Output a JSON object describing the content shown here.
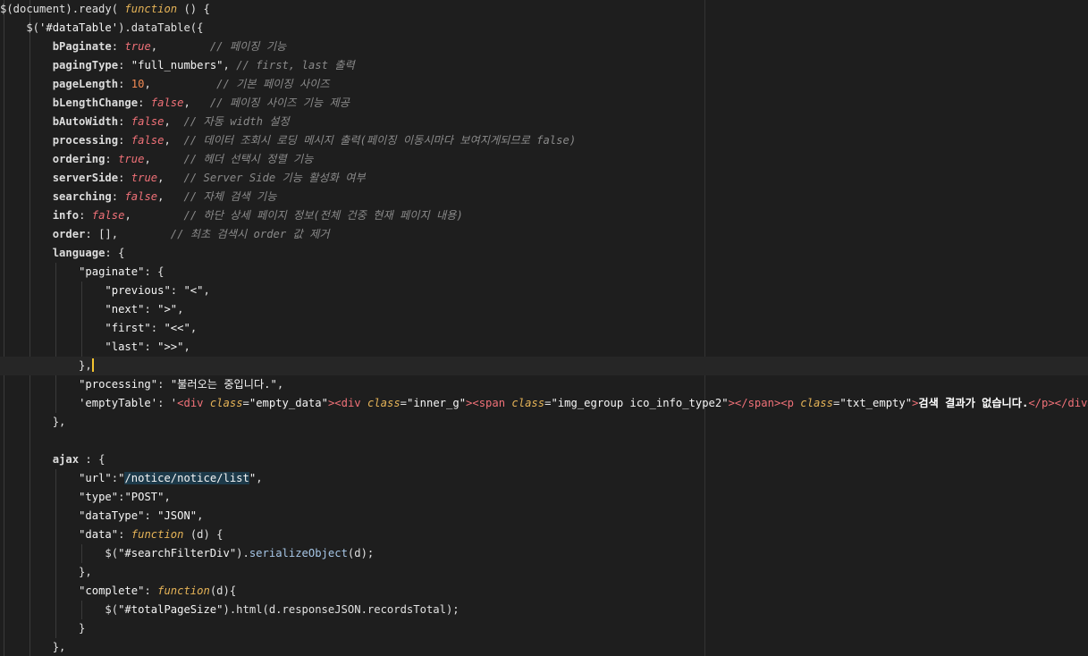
{
  "editor": {
    "colors": {
      "background": "#1e1e1e",
      "current_line": "#262626",
      "cursor": "#f4c430",
      "plain": "#e0e0e0",
      "keyword": "#e5b357",
      "boolean": "#f07178",
      "number": "#f28b54",
      "comment": "#8a8a8a",
      "tag": "#f07178"
    },
    "lines": [
      [
        [
          "plain",
          "$(document).ready( "
        ],
        [
          "kw",
          "function"
        ],
        [
          "plain",
          " () {"
        ]
      ],
      [
        [
          "plain",
          "    $("
        ],
        [
          "str",
          "'#dataTable'"
        ],
        [
          "plain",
          ").dataTable({"
        ]
      ],
      [
        [
          "plain",
          "        "
        ],
        [
          "key",
          "bPaginate"
        ],
        [
          "plain",
          ": "
        ],
        [
          "bool",
          "true"
        ],
        [
          "plain",
          ",        "
        ],
        [
          "cmt",
          "// 페이징 기능"
        ]
      ],
      [
        [
          "plain",
          "        "
        ],
        [
          "key",
          "pagingType"
        ],
        [
          "plain",
          ": "
        ],
        [
          "str",
          "\"full_numbers\""
        ],
        [
          "plain",
          ", "
        ],
        [
          "cmt",
          "// first, last 출력"
        ]
      ],
      [
        [
          "plain",
          "        "
        ],
        [
          "key",
          "pageLength"
        ],
        [
          "plain",
          ": "
        ],
        [
          "num",
          "10"
        ],
        [
          "plain",
          ",          "
        ],
        [
          "cmt",
          "// 기본 페이징 사이즈"
        ]
      ],
      [
        [
          "plain",
          "        "
        ],
        [
          "key",
          "bLengthChange"
        ],
        [
          "plain",
          ": "
        ],
        [
          "bool",
          "false"
        ],
        [
          "plain",
          ",   "
        ],
        [
          "cmt",
          "// 페이징 사이즈 기능 제공"
        ]
      ],
      [
        [
          "plain",
          "        "
        ],
        [
          "key",
          "bAutoWidth"
        ],
        [
          "plain",
          ": "
        ],
        [
          "bool",
          "false"
        ],
        [
          "plain",
          ",  "
        ],
        [
          "cmt",
          "// 자동 width 설정"
        ]
      ],
      [
        [
          "plain",
          "        "
        ],
        [
          "key",
          "processing"
        ],
        [
          "plain",
          ": "
        ],
        [
          "bool",
          "false"
        ],
        [
          "plain",
          ",  "
        ],
        [
          "cmt",
          "// 데이터 조회시 로딩 메시지 출력(페이징 이동시마다 보여지게되므로 false)"
        ]
      ],
      [
        [
          "plain",
          "        "
        ],
        [
          "key",
          "ordering"
        ],
        [
          "plain",
          ": "
        ],
        [
          "bool",
          "true"
        ],
        [
          "plain",
          ",     "
        ],
        [
          "cmt",
          "// 헤더 선택시 정렬 기능"
        ]
      ],
      [
        [
          "plain",
          "        "
        ],
        [
          "key",
          "serverSide"
        ],
        [
          "plain",
          ": "
        ],
        [
          "bool",
          "true"
        ],
        [
          "plain",
          ",   "
        ],
        [
          "cmt",
          "// Server Side 기능 활성화 여부"
        ]
      ],
      [
        [
          "plain",
          "        "
        ],
        [
          "key",
          "searching"
        ],
        [
          "plain",
          ": "
        ],
        [
          "bool",
          "false"
        ],
        [
          "plain",
          ",   "
        ],
        [
          "cmt",
          "// 자체 검색 기능"
        ]
      ],
      [
        [
          "plain",
          "        "
        ],
        [
          "key",
          "info"
        ],
        [
          "plain",
          ": "
        ],
        [
          "bool",
          "false"
        ],
        [
          "plain",
          ",        "
        ],
        [
          "cmt",
          "// 하단 상세 페이지 정보(전체 건중 현재 페이지 내용)"
        ]
      ],
      [
        [
          "plain",
          "        "
        ],
        [
          "key",
          "order"
        ],
        [
          "plain",
          ": [],        "
        ],
        [
          "cmt",
          "// 최초 검색시 order 값 제거"
        ]
      ],
      [
        [
          "plain",
          "        "
        ],
        [
          "key",
          "language"
        ],
        [
          "plain",
          ": {"
        ]
      ],
      [
        [
          "plain",
          "            "
        ],
        [
          "str",
          "\"paginate\""
        ],
        [
          "plain",
          ": {"
        ]
      ],
      [
        [
          "plain",
          "                "
        ],
        [
          "str",
          "\"previous\""
        ],
        [
          "plain",
          ": "
        ],
        [
          "str",
          "\"<\""
        ],
        [
          "plain",
          ","
        ]
      ],
      [
        [
          "plain",
          "                "
        ],
        [
          "str",
          "\"next\""
        ],
        [
          "plain",
          ": "
        ],
        [
          "str",
          "\">\""
        ],
        [
          "plain",
          ","
        ]
      ],
      [
        [
          "plain",
          "                "
        ],
        [
          "str",
          "\"first\""
        ],
        [
          "plain",
          ": "
        ],
        [
          "str",
          "\"<<\""
        ],
        [
          "plain",
          ","
        ]
      ],
      [
        [
          "plain",
          "                "
        ],
        [
          "str",
          "\"last\""
        ],
        [
          "plain",
          ": "
        ],
        [
          "str",
          "\">>\""
        ],
        [
          "plain",
          ","
        ]
      ],
      [
        [
          "plain",
          "            },"
        ]
      ],
      [
        [
          "plain",
          "            "
        ],
        [
          "str",
          "\"processing\""
        ],
        [
          "plain",
          ": "
        ],
        [
          "str",
          "\"불러오는 중입니다.\""
        ],
        [
          "plain",
          ","
        ]
      ],
      [
        [
          "plain",
          "            "
        ],
        [
          "str",
          "'emptyTable'"
        ],
        [
          "plain",
          ": '"
        ],
        [
          "tag",
          "<div"
        ],
        [
          "plain",
          " "
        ],
        [
          "attr",
          "class"
        ],
        [
          "plain",
          "="
        ],
        [
          "aval",
          "\"empty_data\""
        ],
        [
          "tag",
          "><div"
        ],
        [
          "plain",
          " "
        ],
        [
          "attr",
          "class"
        ],
        [
          "plain",
          "="
        ],
        [
          "aval",
          "\"inner_g\""
        ],
        [
          "tag",
          "><span"
        ],
        [
          "plain",
          " "
        ],
        [
          "attr",
          "class"
        ],
        [
          "plain",
          "="
        ],
        [
          "aval",
          "\"img_egroup ico_info_type2\""
        ],
        [
          "tag",
          "></span><p"
        ],
        [
          "plain",
          " "
        ],
        [
          "attr",
          "class"
        ],
        [
          "plain",
          "="
        ],
        [
          "aval",
          "\"txt_empty\""
        ],
        [
          "tag",
          ">"
        ],
        [
          "text",
          "검색 결과가 없습니다."
        ],
        [
          "tag",
          "</p></div></div>"
        ],
        [
          "plain",
          "'"
        ]
      ],
      [
        [
          "plain",
          "        },"
        ]
      ],
      [
        [
          "plain",
          ""
        ]
      ],
      [
        [
          "plain",
          "        "
        ],
        [
          "key",
          "ajax"
        ],
        [
          "plain",
          " : {"
        ]
      ],
      [
        [
          "plain",
          "            "
        ],
        [
          "str",
          "\"url\""
        ],
        [
          "plain",
          ":"
        ],
        [
          "str",
          "\""
        ],
        [
          "sel",
          "/notice/notice/list"
        ],
        [
          "str",
          "\""
        ],
        [
          "plain",
          ","
        ]
      ],
      [
        [
          "plain",
          "            "
        ],
        [
          "str",
          "\"type\""
        ],
        [
          "plain",
          ":"
        ],
        [
          "str",
          "\"POST\""
        ],
        [
          "plain",
          ","
        ]
      ],
      [
        [
          "plain",
          "            "
        ],
        [
          "str",
          "\"dataType\""
        ],
        [
          "plain",
          ": "
        ],
        [
          "str",
          "\"JSON\""
        ],
        [
          "plain",
          ","
        ]
      ],
      [
        [
          "plain",
          "            "
        ],
        [
          "str",
          "\"data\""
        ],
        [
          "plain",
          ": "
        ],
        [
          "kw",
          "function"
        ],
        [
          "plain",
          " (d) {"
        ]
      ],
      [
        [
          "plain",
          "                $("
        ],
        [
          "str",
          "\"#searchFilterDiv\""
        ],
        [
          "plain",
          ")."
        ],
        [
          "fn",
          "serializeObject"
        ],
        [
          "plain",
          "(d);"
        ]
      ],
      [
        [
          "plain",
          "            },"
        ]
      ],
      [
        [
          "plain",
          "            "
        ],
        [
          "str",
          "\"complete\""
        ],
        [
          "plain",
          ": "
        ],
        [
          "kw",
          "function"
        ],
        [
          "plain",
          "(d){"
        ]
      ],
      [
        [
          "plain",
          "                $("
        ],
        [
          "str",
          "\"#totalPageSize\""
        ],
        [
          "plain",
          ").html(d.responseJSON.recordsTotal);"
        ]
      ],
      [
        [
          "plain",
          "            }"
        ]
      ],
      [
        [
          "plain",
          "        },"
        ]
      ]
    ]
  }
}
